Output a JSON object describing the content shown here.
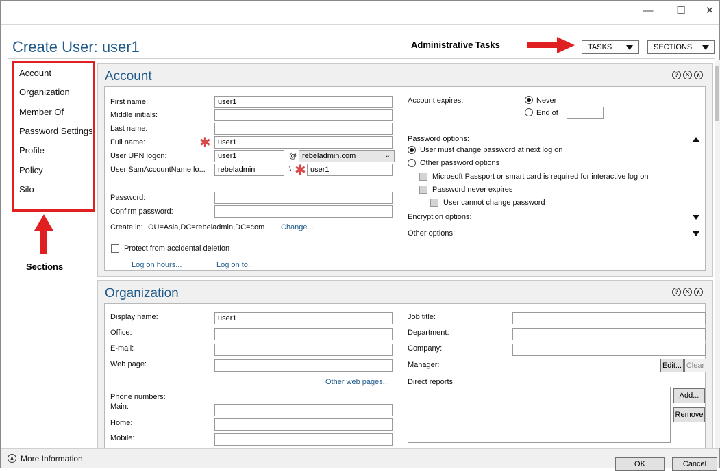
{
  "window": {
    "title": "Create User: user1",
    "minimize": "—",
    "maximize": "☐",
    "close": "✕"
  },
  "annotations": {
    "admin_tasks": "Administrative Tasks",
    "sections": "Sections"
  },
  "header": {
    "tasks_label": "TASKS",
    "sections_label": "SECTIONS"
  },
  "nav": {
    "items": [
      {
        "label": "Account"
      },
      {
        "label": "Organization"
      },
      {
        "label": "Member Of"
      },
      {
        "label": "Password Settings"
      },
      {
        "label": "Profile"
      },
      {
        "label": "Policy"
      },
      {
        "label": "Silo"
      }
    ]
  },
  "account": {
    "title": "Account",
    "first_name_label": "First name:",
    "first_name": "user1",
    "middle_initials_label": "Middle initials:",
    "middle_initials": "",
    "last_name_label": "Last name:",
    "last_name": "",
    "full_name_label": "Full name:",
    "full_name": "user1",
    "upn_label": "User UPN logon:",
    "upn": "user1",
    "upn_at": "@",
    "upn_domain": "rebeladmin.com",
    "sam_label": "User SamAccountName lo...",
    "sam_domain": "rebeladmin",
    "sam_sep": "\\",
    "sam": "user1",
    "password_label": "Password:",
    "confirm_password_label": "Confirm password:",
    "create_in_label": "Create in:",
    "create_in": "OU=Asia,DC=rebeladmin,DC=com",
    "change_link": "Change...",
    "protect_label": "Protect from accidental deletion",
    "protect_checked": false,
    "log_on_hours": "Log on hours...",
    "log_on_to": "Log on to...",
    "expires_label": "Account expires:",
    "never": "Never",
    "end_of": "End of",
    "password_options_label": "Password options:",
    "opt_must_change": "User must change password at next log on",
    "opt_other": "Other password options",
    "opt_smartcard": "Microsoft Passport or smart card is required for interactive log on",
    "opt_never_expires": "Password never expires",
    "opt_cannot_change": "User cannot change password",
    "encryption_label": "Encryption options:",
    "other_options_label": "Other options:"
  },
  "organization": {
    "title": "Organization",
    "display_name_label": "Display name:",
    "display_name": "user1",
    "office_label": "Office:",
    "email_label": "E-mail:",
    "web_page_label": "Web page:",
    "other_web_pages": "Other web pages...",
    "phone_numbers_label": "Phone numbers:",
    "main_label": "Main:",
    "home_label": "Home:",
    "mobile_label": "Mobile:",
    "job_title_label": "Job title:",
    "department_label": "Department:",
    "company_label": "Company:",
    "manager_label": "Manager:",
    "edit_label": "Edit...",
    "clear_label": "Clear",
    "direct_reports_label": "Direct reports:",
    "add_label": "Add...",
    "remove_label": "Remove"
  },
  "footer": {
    "more_info": "More Information",
    "ok": "OK",
    "cancel": "Cancel"
  },
  "colors": {
    "accent": "#1f5a8a",
    "annotation_red": "#e02020",
    "panel_bg": "#f0f0f0"
  }
}
